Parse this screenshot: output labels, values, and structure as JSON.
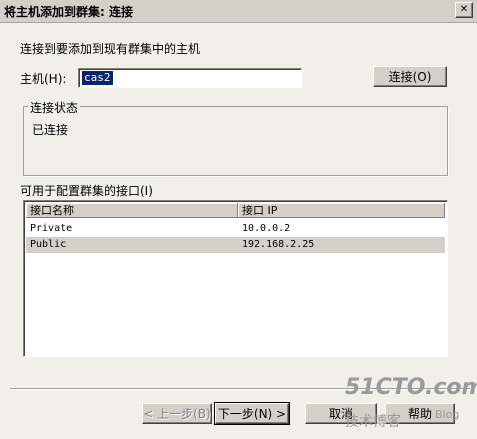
{
  "window": {
    "title": "将主机添加到群集:  连接",
    "close_glyph": "✕"
  },
  "intro": "连接到要添加到现有群集中的主机",
  "host": {
    "label": "主机(H):",
    "value": "cas2",
    "connect_button": "连接(O)"
  },
  "status_group": {
    "title": "连接状态",
    "text": "已连接"
  },
  "interfaces": {
    "label": "可用于配置群集的接口(I)",
    "columns": [
      "接口名称",
      "接口 IP"
    ],
    "rows": [
      [
        "Private",
        "10.0.0.2"
      ],
      [
        "Public",
        "192.168.2.25"
      ]
    ]
  },
  "footer": {
    "back_button": "< 上一步(B)",
    "next_button": "下一步(N) >",
    "cancel_button": "取消",
    "help_button": "帮助"
  },
  "watermark": {
    "logo": "51CTO.com",
    "sub": "技术博客",
    "blog": "Blog"
  },
  "colors": {
    "selection": "#0a246a",
    "face": "#d4d0c8",
    "panel": "#f0efe8"
  }
}
